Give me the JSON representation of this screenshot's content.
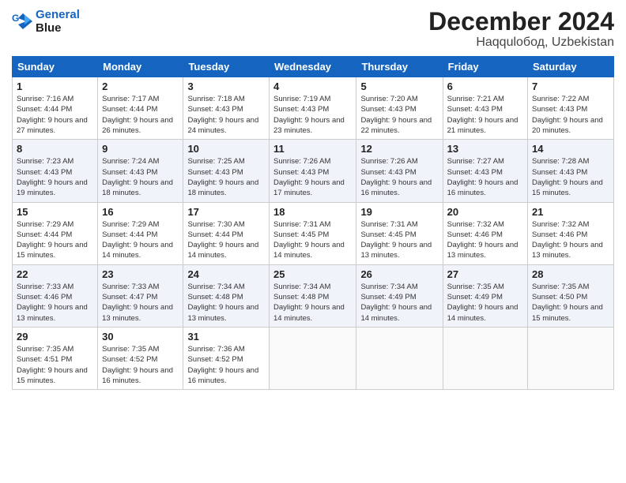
{
  "header": {
    "logo_line1": "General",
    "logo_line2": "Blue",
    "month": "December 2024",
    "location": "Haqqulобод, Uzbekistan"
  },
  "weekdays": [
    "Sunday",
    "Monday",
    "Tuesday",
    "Wednesday",
    "Thursday",
    "Friday",
    "Saturday"
  ],
  "weeks": [
    [
      {
        "day": "1",
        "sunrise": "7:16 AM",
        "sunset": "4:44 PM",
        "daylight": "9 hours and 27 minutes."
      },
      {
        "day": "2",
        "sunrise": "7:17 AM",
        "sunset": "4:44 PM",
        "daylight": "9 hours and 26 minutes."
      },
      {
        "day": "3",
        "sunrise": "7:18 AM",
        "sunset": "4:43 PM",
        "daylight": "9 hours and 24 minutes."
      },
      {
        "day": "4",
        "sunrise": "7:19 AM",
        "sunset": "4:43 PM",
        "daylight": "9 hours and 23 minutes."
      },
      {
        "day": "5",
        "sunrise": "7:20 AM",
        "sunset": "4:43 PM",
        "daylight": "9 hours and 22 minutes."
      },
      {
        "day": "6",
        "sunrise": "7:21 AM",
        "sunset": "4:43 PM",
        "daylight": "9 hours and 21 minutes."
      },
      {
        "day": "7",
        "sunrise": "7:22 AM",
        "sunset": "4:43 PM",
        "daylight": "9 hours and 20 minutes."
      }
    ],
    [
      {
        "day": "8",
        "sunrise": "7:23 AM",
        "sunset": "4:43 PM",
        "daylight": "9 hours and 19 minutes."
      },
      {
        "day": "9",
        "sunrise": "7:24 AM",
        "sunset": "4:43 PM",
        "daylight": "9 hours and 18 minutes."
      },
      {
        "day": "10",
        "sunrise": "7:25 AM",
        "sunset": "4:43 PM",
        "daylight": "9 hours and 18 minutes."
      },
      {
        "day": "11",
        "sunrise": "7:26 AM",
        "sunset": "4:43 PM",
        "daylight": "9 hours and 17 minutes."
      },
      {
        "day": "12",
        "sunrise": "7:26 AM",
        "sunset": "4:43 PM",
        "daylight": "9 hours and 16 minutes."
      },
      {
        "day": "13",
        "sunrise": "7:27 AM",
        "sunset": "4:43 PM",
        "daylight": "9 hours and 16 minutes."
      },
      {
        "day": "14",
        "sunrise": "7:28 AM",
        "sunset": "4:43 PM",
        "daylight": "9 hours and 15 minutes."
      }
    ],
    [
      {
        "day": "15",
        "sunrise": "7:29 AM",
        "sunset": "4:44 PM",
        "daylight": "9 hours and 15 minutes."
      },
      {
        "day": "16",
        "sunrise": "7:29 AM",
        "sunset": "4:44 PM",
        "daylight": "9 hours and 14 minutes."
      },
      {
        "day": "17",
        "sunrise": "7:30 AM",
        "sunset": "4:44 PM",
        "daylight": "9 hours and 14 minutes."
      },
      {
        "day": "18",
        "sunrise": "7:31 AM",
        "sunset": "4:45 PM",
        "daylight": "9 hours and 14 minutes."
      },
      {
        "day": "19",
        "sunrise": "7:31 AM",
        "sunset": "4:45 PM",
        "daylight": "9 hours and 13 minutes."
      },
      {
        "day": "20",
        "sunrise": "7:32 AM",
        "sunset": "4:46 PM",
        "daylight": "9 hours and 13 minutes."
      },
      {
        "day": "21",
        "sunrise": "7:32 AM",
        "sunset": "4:46 PM",
        "daylight": "9 hours and 13 minutes."
      }
    ],
    [
      {
        "day": "22",
        "sunrise": "7:33 AM",
        "sunset": "4:46 PM",
        "daylight": "9 hours and 13 minutes."
      },
      {
        "day": "23",
        "sunrise": "7:33 AM",
        "sunset": "4:47 PM",
        "daylight": "9 hours and 13 minutes."
      },
      {
        "day": "24",
        "sunrise": "7:34 AM",
        "sunset": "4:48 PM",
        "daylight": "9 hours and 13 minutes."
      },
      {
        "day": "25",
        "sunrise": "7:34 AM",
        "sunset": "4:48 PM",
        "daylight": "9 hours and 14 minutes."
      },
      {
        "day": "26",
        "sunrise": "7:34 AM",
        "sunset": "4:49 PM",
        "daylight": "9 hours and 14 minutes."
      },
      {
        "day": "27",
        "sunrise": "7:35 AM",
        "sunset": "4:49 PM",
        "daylight": "9 hours and 14 minutes."
      },
      {
        "day": "28",
        "sunrise": "7:35 AM",
        "sunset": "4:50 PM",
        "daylight": "9 hours and 15 minutes."
      }
    ],
    [
      {
        "day": "29",
        "sunrise": "7:35 AM",
        "sunset": "4:51 PM",
        "daylight": "9 hours and 15 minutes."
      },
      {
        "day": "30",
        "sunrise": "7:35 AM",
        "sunset": "4:52 PM",
        "daylight": "9 hours and 16 minutes."
      },
      {
        "day": "31",
        "sunrise": "7:36 AM",
        "sunset": "4:52 PM",
        "daylight": "9 hours and 16 minutes."
      },
      null,
      null,
      null,
      null
    ]
  ]
}
